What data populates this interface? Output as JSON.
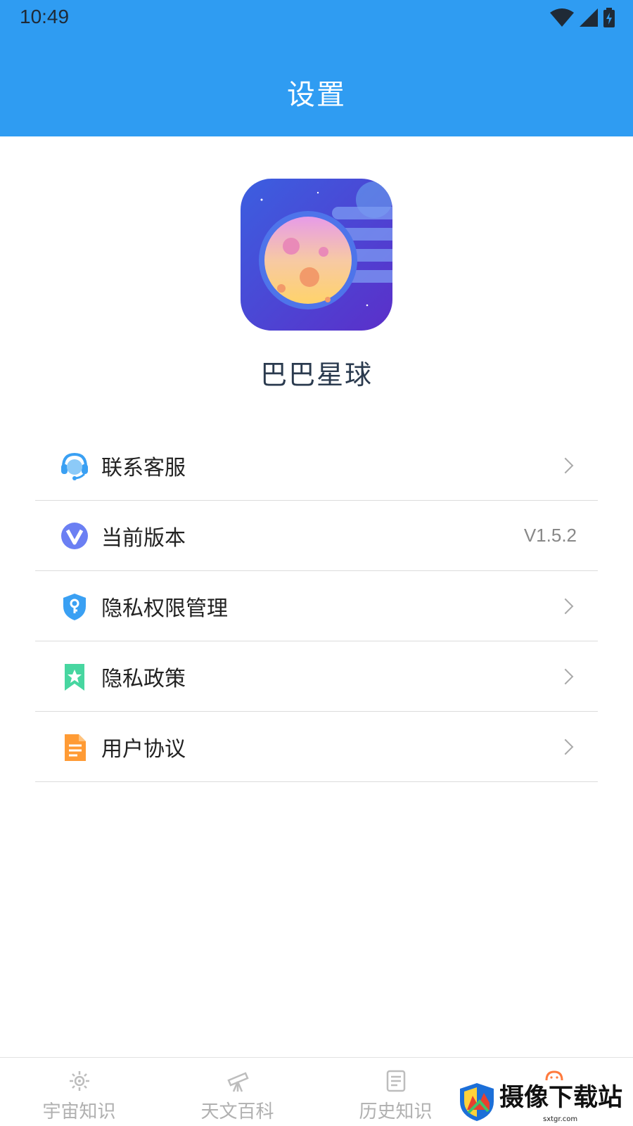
{
  "status_bar": {
    "time": "10:49"
  },
  "header": {
    "title": "设置"
  },
  "app": {
    "name": "巴巴星球"
  },
  "menu": {
    "items": [
      {
        "label": "联系客服",
        "icon": "headset-icon"
      },
      {
        "label": "当前版本",
        "icon": "version-icon",
        "value": "V1.5.2"
      },
      {
        "label": "隐私权限管理",
        "icon": "shield-key-icon"
      },
      {
        "label": "隐私政策",
        "icon": "bookmark-star-icon"
      },
      {
        "label": "用户协议",
        "icon": "document-icon"
      }
    ]
  },
  "bottom_nav": {
    "items": [
      {
        "label": "宇宙知识",
        "icon": "galaxy-icon"
      },
      {
        "label": "天文百科",
        "icon": "telescope-icon"
      },
      {
        "label": "历史知识",
        "icon": "news-icon"
      },
      {
        "label": "",
        "icon": "profile-icon"
      }
    ]
  },
  "watermark": {
    "title": "摄像下载站",
    "url": "sxtgr.com"
  },
  "colors": {
    "header_bg": "#2f9cf2",
    "divider": "#dcdcdc",
    "nav_inactive": "#b0b0b0"
  }
}
